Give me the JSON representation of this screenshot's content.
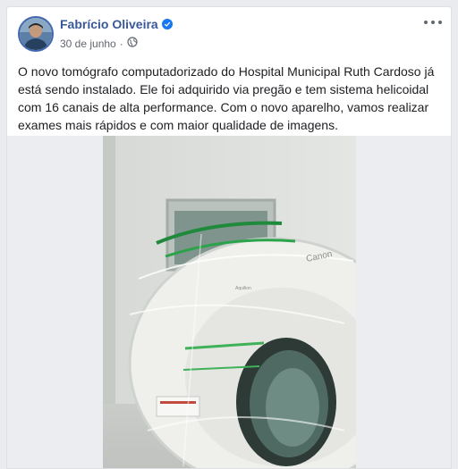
{
  "post": {
    "author": "Fabrício Oliveira",
    "date": "30 de junho",
    "privacy_icon": "globe-icon",
    "verified_icon": "verified-badge-icon",
    "more_icon": "more-options-icon",
    "text": "O novo tomógrafo computadorizado do Hospital Municipal Ruth Cardoso já está sendo instalado. Ele foi adquirido via pregão e tem sistema helicoidal com 16 canais de alta performance. Com o novo aparelho, vamos realizar exames mais rápidos e com maior qualidade de imagens."
  },
  "media": {
    "brand_mark": "Canon",
    "model_mark": "Aquilion"
  },
  "colors": {
    "author_link": "#385898",
    "verified_badge": "#1877f2",
    "page_background": "#e9ebee"
  }
}
